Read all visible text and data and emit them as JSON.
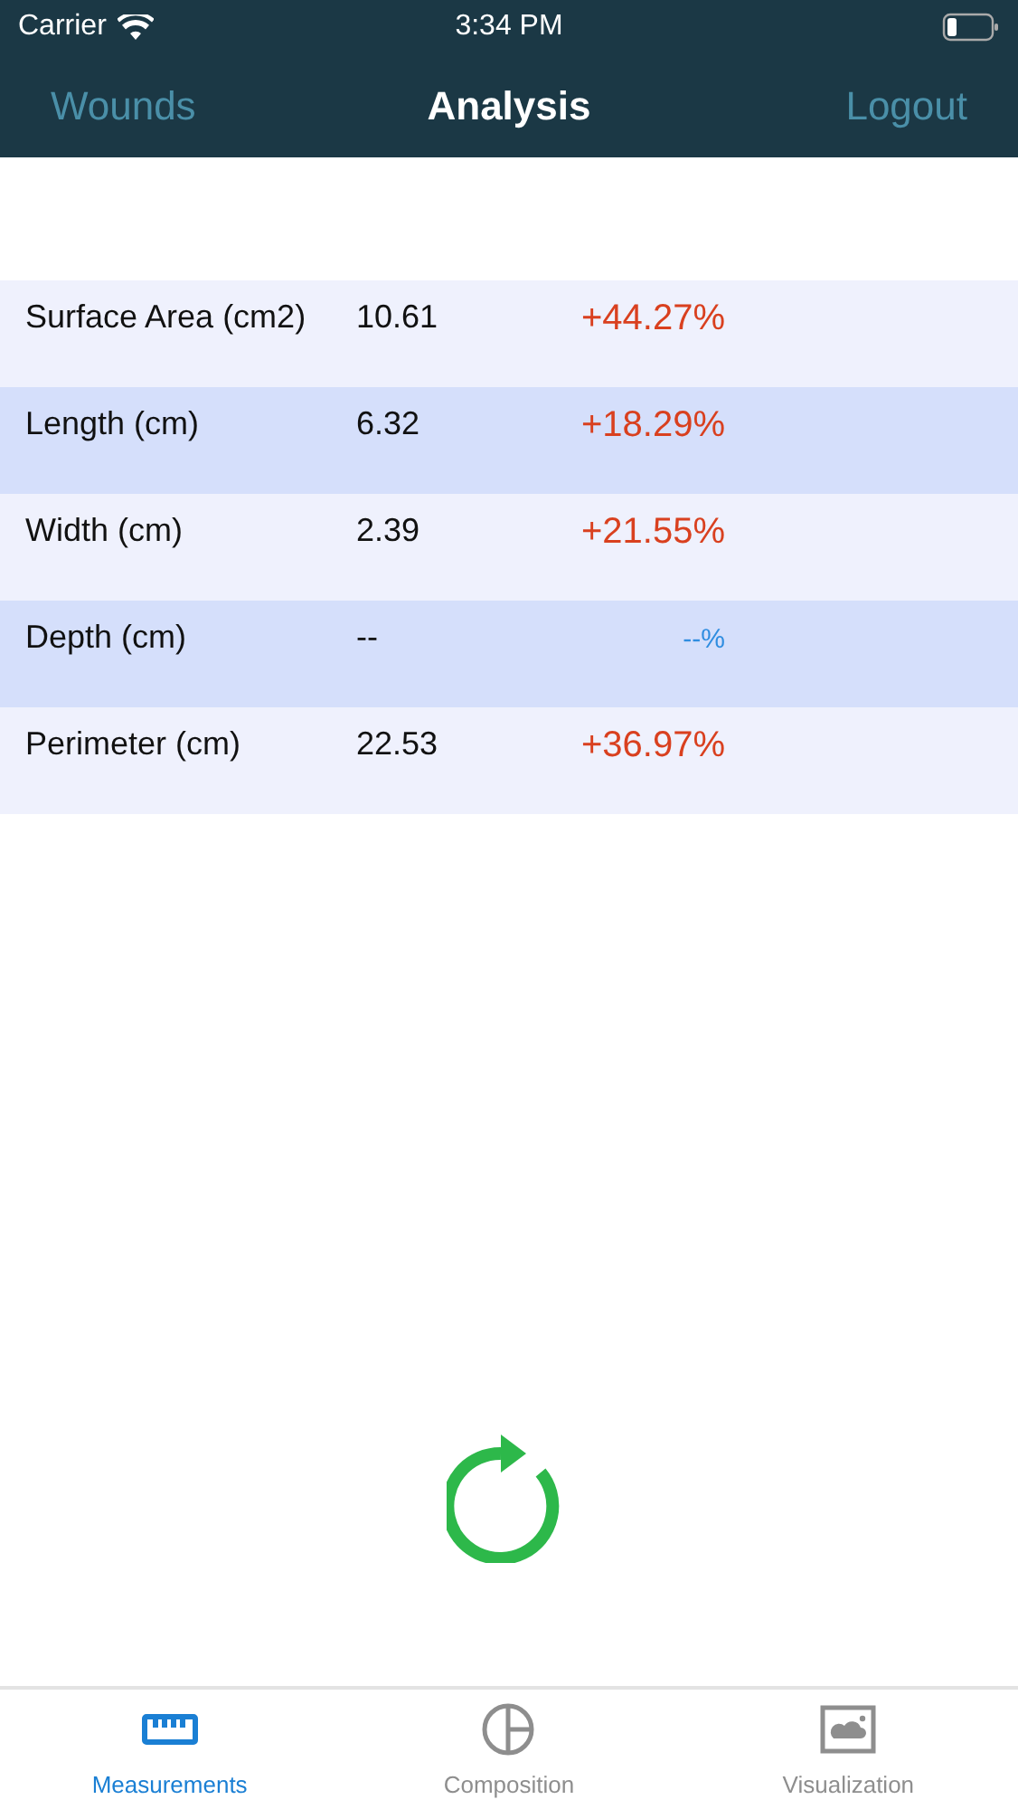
{
  "status_bar": {
    "carrier": "Carrier",
    "time": "3:34 PM"
  },
  "nav": {
    "back": "Wounds",
    "title": "Analysis",
    "action": "Logout"
  },
  "measurements": [
    {
      "name": "Surface Area (cm2)",
      "value": "10.61",
      "change": "+44.27%",
      "kind": "increase"
    },
    {
      "name": "Length (cm)",
      "value": "6.32",
      "change": "+18.29%",
      "kind": "increase"
    },
    {
      "name": "Width (cm)",
      "value": "2.39",
      "change": "+21.55%",
      "kind": "increase"
    },
    {
      "name": "Depth (cm)",
      "value": "--",
      "change": "--%",
      "kind": "none"
    },
    {
      "name": "Perimeter (cm)",
      "value": "22.53",
      "change": "+36.97%",
      "kind": "increase"
    }
  ],
  "tabs": [
    {
      "label": "Measurements",
      "kind": "ruler",
      "selected": true
    },
    {
      "label": "Composition",
      "kind": "pie",
      "selected": false
    },
    {
      "label": "Visualization",
      "kind": "image",
      "selected": false
    }
  ]
}
